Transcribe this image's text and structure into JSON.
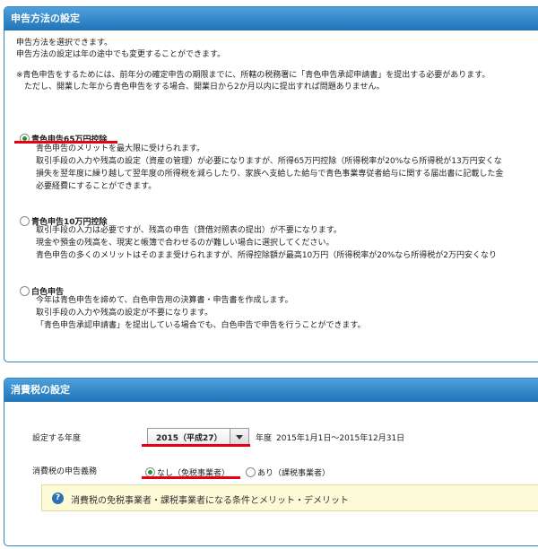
{
  "section1": {
    "title": "申告方法の設定",
    "intro": [
      "申告方法を選択できます。",
      "申告方法の設定は年の途中でも変更することができます。"
    ],
    "note": [
      "※青色申告をするためには、前年分の確定申告の期限までに、所轄の税務署に「青色申告承認申請書」を提出する必要があります。",
      "　ただし、開業した年から青色申告をする場合、開業日から2か月以内に提出すれば問題ありません。"
    ],
    "options": [
      {
        "label": "青色申告65万円控除",
        "checked": true,
        "lines": [
          "青色申告のメリットを最大限に受けられます。",
          "取引手段の入力や残高の設定（資産の管理）が必要になりますが、所得65万円控除（所得税率が20%なら所得税が13万円安くな",
          "損失を翌年度に繰り越して翌年度の所得税を減らしたり、家族へ支給した給与で青色事業専従者給与に関する届出書に記載した金",
          "必要経費にすることができます。"
        ]
      },
      {
        "label": "青色申告10万円控除",
        "checked": false,
        "lines": [
          "取引手段の入力は必要ですが、残高の申告（貸借対照表の提出）が不要になります。",
          "現金や預金の残高を、現実と帳簿で合わせるのが難しい場合に選択してください。",
          "青色申告の多くのメリットはそのまま受けられますが、所得控除額が最高10万円（所得税率が20%なら所得税が2万円安くなり"
        ]
      },
      {
        "label": "白色申告",
        "checked": false,
        "lines": [
          "今年は青色申告を諦めて、白色申告用の決算書・申告書を作成します。",
          "取引手段の入力や残高の設定が不要になります。",
          "「青色申告承認申請書」を提出している場合でも、白色申告で申告を行うことができます。"
        ]
      }
    ]
  },
  "section2": {
    "title": "消費税の設定",
    "year_label": "設定する年度",
    "year_value": "2015（平成27）",
    "year_suffix": "年度",
    "year_range": "2015年1月1日〜2015年12月31日",
    "duty_label": "消費税の申告義務",
    "duty_options": [
      {
        "label": "なし（免税事業者）",
        "checked": true
      },
      {
        "label": "あり（課税事業者）",
        "checked": false
      }
    ],
    "info_icon": "question-icon",
    "info_text": "消費税の免税事業者・課税事業者になる条件とメリット・デメリット"
  },
  "colors": {
    "header_blue": "#2f84c4",
    "highlight_red": "#e60012",
    "radio_green": "#1a9a2a",
    "info_bg": "#fdfad8"
  }
}
